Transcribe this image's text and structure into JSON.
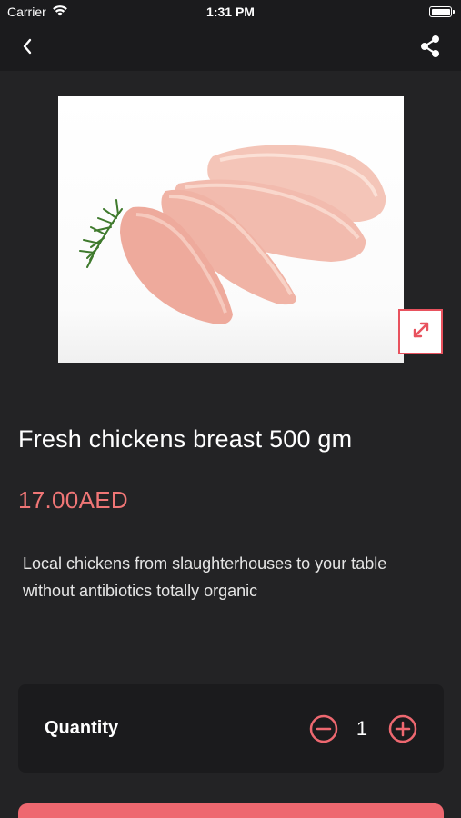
{
  "status_bar": {
    "carrier": "Carrier",
    "time": "1:31 PM",
    "icons": [
      "wifi-icon",
      "battery-icon"
    ]
  },
  "nav": {
    "back_icon": "chevron-left-icon",
    "share_icon": "share-icon"
  },
  "product": {
    "title": "Fresh chickens breast 500 gm",
    "price": "17.00AED",
    "description": "Local chickens from slaughterhouses to your table without antibiotics totally organic",
    "expand_icon": "expand-icon"
  },
  "quantity": {
    "label": "Quantity",
    "value": "1",
    "minus_icon": "minus-circle-icon",
    "plus_icon": "plus-circle-icon"
  },
  "colors": {
    "background": "#232325",
    "bar": "#1b1b1d",
    "accent": "#ee6870",
    "price": "#f07676"
  }
}
